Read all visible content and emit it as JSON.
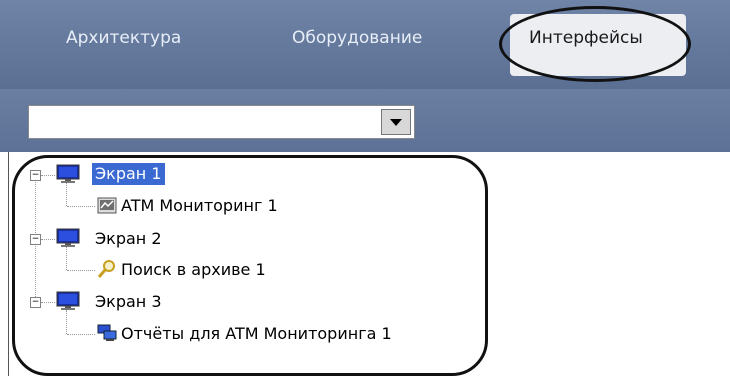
{
  "tabs": [
    {
      "label": "Архитектура",
      "active": false
    },
    {
      "label": "Оборудование",
      "active": false
    },
    {
      "label": "Интерфейсы",
      "active": true
    }
  ],
  "combo": {
    "value": ""
  },
  "tree": {
    "screens": [
      {
        "label": "Экран 1",
        "selected": true,
        "child": {
          "label": "ATM Мониторинг 1",
          "icon": "atm-monitoring-icon"
        }
      },
      {
        "label": "Экран 2",
        "selected": false,
        "child": {
          "label": "Поиск в архиве 1",
          "icon": "archive-search-icon"
        }
      },
      {
        "label": "Экран 3",
        "selected": false,
        "child": {
          "label": "Отчёты для ATM Мониторинга 1",
          "icon": "reports-icon"
        }
      }
    ]
  },
  "colors": {
    "header": "#5f7497",
    "selection": "#3a6ad1",
    "annotation": "#111111"
  }
}
